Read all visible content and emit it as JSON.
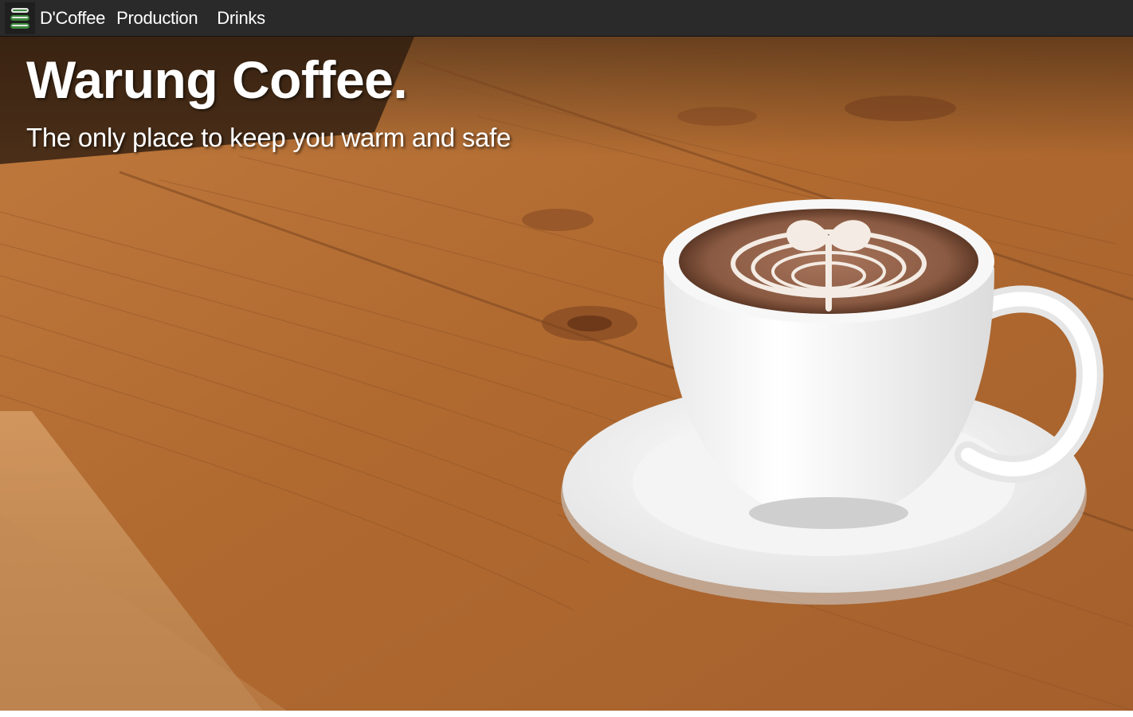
{
  "navbar": {
    "logo_icon": "stacked-cups-logo-icon",
    "brand_label": "D'Coffee",
    "links": [
      {
        "label": "Production"
      },
      {
        "label": "Drinks"
      }
    ]
  },
  "hero": {
    "title": "Warung Coffee.",
    "subtitle": "The only place to keep you warm and safe",
    "image_subject": "latte-art-cup-on-wooden-table"
  },
  "colors": {
    "navbar_bg": "#2a2a2a",
    "logo_green": "#3c8a3c",
    "wood_base": "#b5703a",
    "text_white": "#ffffff"
  }
}
